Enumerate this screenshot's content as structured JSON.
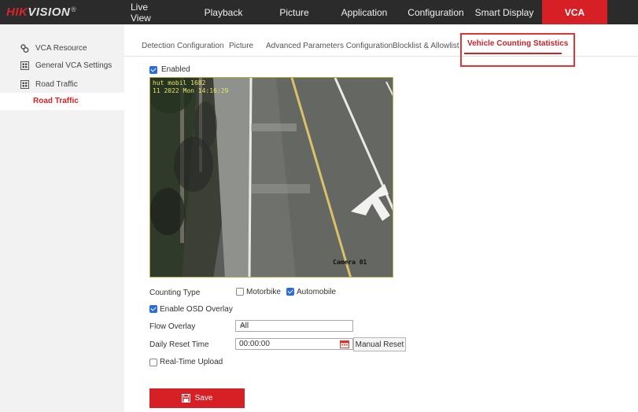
{
  "brand": {
    "name_red": "HIK",
    "name_rest": "VISION",
    "mark": "®"
  },
  "nav": [
    {
      "label": "Live View",
      "active": false
    },
    {
      "label": "Playback",
      "active": false
    },
    {
      "label": "Picture",
      "active": false
    },
    {
      "label": "Application",
      "active": false
    },
    {
      "label": "Configuration",
      "active": false
    },
    {
      "label": "Smart Display",
      "active": false
    },
    {
      "label": "VCA",
      "active": true
    }
  ],
  "sidebar": {
    "items": [
      {
        "label": "VCA Resource",
        "icon": "vca-resource-icon"
      },
      {
        "label": "General VCA Settings",
        "icon": "grid-icon"
      },
      {
        "label": "Road Traffic",
        "icon": "grid-icon"
      }
    ],
    "sub_item": "Road Traffic"
  },
  "tabs": [
    {
      "label": "Detection Configuration"
    },
    {
      "label": "Picture"
    },
    {
      "label": "Advanced Parameters Configuration"
    },
    {
      "label": "Blocklist & Allowlist"
    },
    {
      "label": "Vehicle Counting Statistics",
      "active": true
    }
  ],
  "form": {
    "enabled_label": "Enabled",
    "enabled": true,
    "video": {
      "osd_line1": "hut mobil  1682",
      "osd_line2": "11 2022 Mon 14:16:29",
      "camera_label": "Camera 01"
    },
    "counting_type_label": "Counting Type",
    "motorbike_label": "Motorbike",
    "motorbike_checked": false,
    "automobile_label": "Automobile",
    "automobile_checked": true,
    "osd_overlay_label": "Enable OSD Overlay",
    "osd_overlay_checked": true,
    "flow_overlay_label": "Flow Overlay",
    "flow_overlay_value": "All",
    "daily_reset_label": "Daily Reset Time",
    "daily_reset_value": "00:00:00",
    "manual_reset_label": "Manual Reset",
    "realtime_upload_label": "Real-Time Upload",
    "realtime_upload_checked": false,
    "save_label": "Save"
  },
  "colors": {
    "accent": "#d71f26",
    "topbar": "#2b2b2b",
    "checkbox": "#2d6fd1"
  }
}
